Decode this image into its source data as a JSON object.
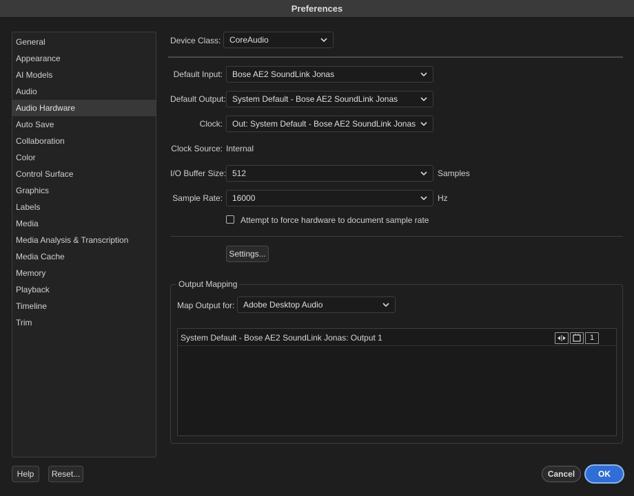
{
  "window": {
    "title": "Preferences"
  },
  "sidebar": {
    "items": [
      {
        "label": "General"
      },
      {
        "label": "Appearance"
      },
      {
        "label": "AI Models"
      },
      {
        "label": "Audio"
      },
      {
        "label": "Audio Hardware",
        "selected": true
      },
      {
        "label": "Auto Save"
      },
      {
        "label": "Collaboration"
      },
      {
        "label": "Color"
      },
      {
        "label": "Control Surface"
      },
      {
        "label": "Graphics"
      },
      {
        "label": "Labels"
      },
      {
        "label": "Media"
      },
      {
        "label": "Media Analysis & Transcription"
      },
      {
        "label": "Media Cache"
      },
      {
        "label": "Memory"
      },
      {
        "label": "Playback"
      },
      {
        "label": "Timeline"
      },
      {
        "label": "Trim"
      }
    ]
  },
  "device_class": {
    "label": "Device Class:",
    "value": "CoreAudio"
  },
  "default_input": {
    "label": "Default Input:",
    "value": "Bose AE2 SoundLink Jonas"
  },
  "default_output": {
    "label": "Default Output:",
    "value": "System Default - Bose AE2 SoundLink Jonas"
  },
  "clock": {
    "label": "Clock:",
    "value": "Out: System Default - Bose AE2 SoundLink Jonas"
  },
  "clock_source": {
    "label": "Clock Source:",
    "value": "Internal"
  },
  "buffer_size": {
    "label": "I/O Buffer Size:",
    "value": "512",
    "unit": "Samples"
  },
  "sample_rate": {
    "label": "Sample Rate:",
    "value": "16000",
    "unit": "Hz"
  },
  "force_rate": {
    "label": "Attempt to force hardware to document sample rate",
    "checked": false
  },
  "settings_button": "Settings...",
  "output_mapping": {
    "title": "Output Mapping",
    "map_label": "Map Output for:",
    "map_value": "Adobe Desktop Audio",
    "rows": [
      {
        "label": "System Default - Bose AE2 SoundLink Jonas: Output 1",
        "channel": "1"
      }
    ]
  },
  "footer": {
    "help": "Help",
    "reset": "Reset...",
    "cancel": "Cancel",
    "ok": "OK"
  },
  "colors": {
    "accent": "#2f6ed8",
    "background": "#1e1e1e"
  }
}
